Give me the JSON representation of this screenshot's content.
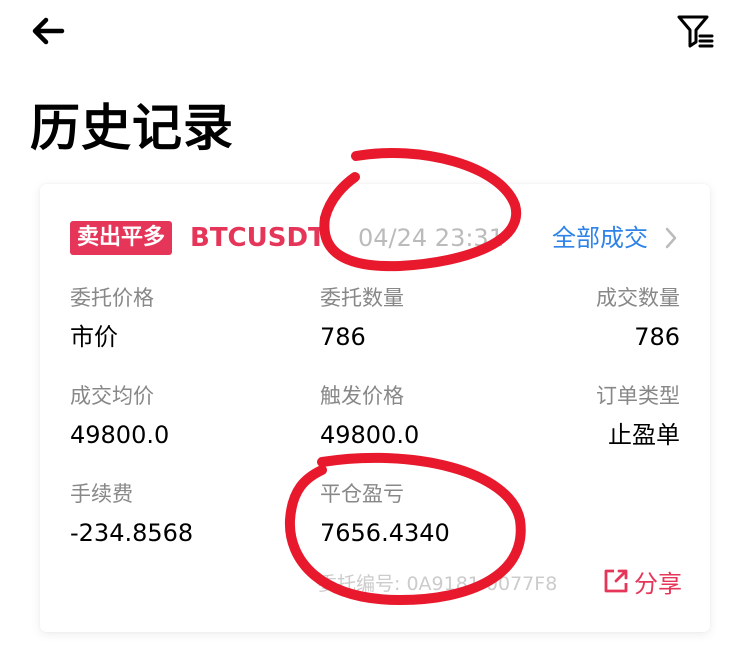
{
  "page": {
    "title": "历史记录"
  },
  "order": {
    "side": "卖出平多",
    "symbol": "BTCUSDT",
    "time": "04/24 23:31",
    "all_trades_label": "全部成交",
    "fields": {
      "order_price": {
        "label": "委托价格",
        "value": "市价"
      },
      "order_qty": {
        "label": "委托数量",
        "value": "786"
      },
      "filled_qty": {
        "label": "成交数量",
        "value": "786"
      },
      "avg_price": {
        "label": "成交均价",
        "value": "49800.0"
      },
      "trigger_price": {
        "label": "触发价格",
        "value": "49800.0"
      },
      "order_type": {
        "label": "订单类型",
        "value": "止盈单"
      },
      "fee": {
        "label": "手续费",
        "value": "-234.8568"
      },
      "close_pnl": {
        "label": "平仓盈亏",
        "value": "7656.4340"
      }
    },
    "order_id": "委托编号: 0A9181 0077F8",
    "share_label": "分享"
  },
  "colors": {
    "accent_red": "#e5365a",
    "link_blue": "#2d83e8",
    "annotation_red": "#e8192c"
  },
  "icons": {
    "back": "arrow-left-icon",
    "filter": "filter-icon",
    "chevron": "chevron-right-icon",
    "share": "share-icon"
  }
}
